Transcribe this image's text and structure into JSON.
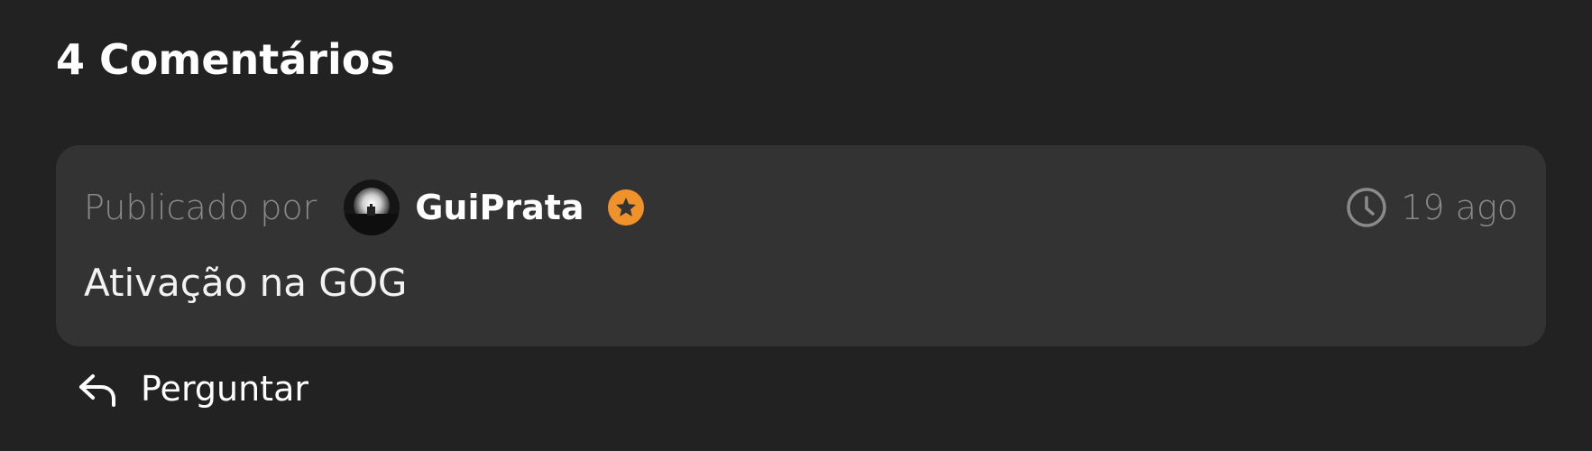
{
  "comments_section": {
    "heading": "4 Comentários"
  },
  "comment": {
    "posted_by_label": "Publicado por",
    "author": "GuiPrata",
    "author_badge_icon": "star-icon",
    "timestamp_icon": "clock-icon",
    "timestamp": "19 ago",
    "body": "Ativação na GOG"
  },
  "actions": {
    "reply_icon": "reply-arrow-icon",
    "reply_label": "Perguntar"
  },
  "colors": {
    "page_background": "#222222",
    "card_background": "#333333",
    "muted_text": "#8a8a8a",
    "badge_orange": "#f0922b"
  }
}
